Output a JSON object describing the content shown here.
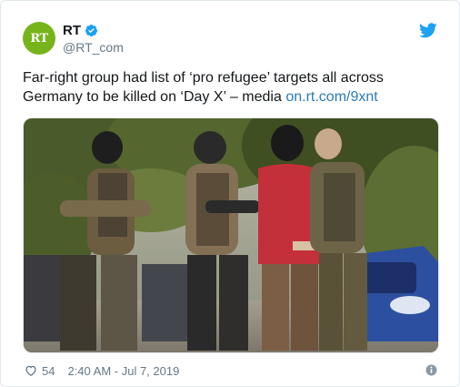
{
  "account": {
    "avatar_text": "RT",
    "display_name": "RT",
    "handle": "@RT_com",
    "verified": true
  },
  "tweet": {
    "text": "Far-right group had list of ‘pro refugee’ targets all across Germany to be killed on ‘Day X’ – media ",
    "link_text": "on.rt.com/9xnt"
  },
  "media": {
    "description_icon": "photo-image"
  },
  "footer": {
    "like_count": "54",
    "timestamp": "2:40 AM - Jul 7, 2019"
  },
  "icons": {
    "brand": "twitter-bird-icon",
    "verified": "verified-badge-icon",
    "like": "heart-icon",
    "info": "info-icon"
  },
  "colors": {
    "twitter_blue": "#1da1f2",
    "link_blue": "#2b7bb9",
    "rt_green": "#77b41b",
    "muted_text": "#657786"
  }
}
